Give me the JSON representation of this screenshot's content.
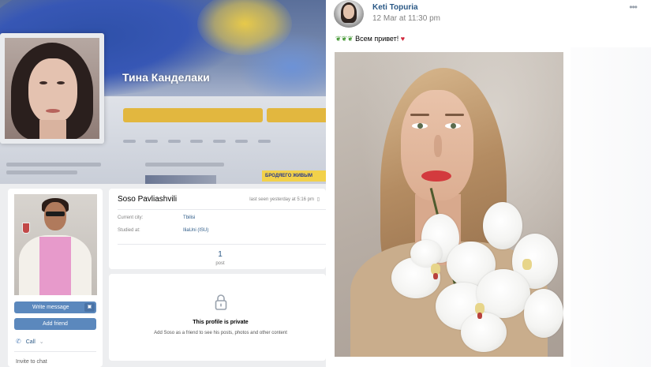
{
  "top_left": {
    "profile_name": "Тина Канделаки",
    "tag": "БРОДЯЕГО ЖИВЫМ"
  },
  "bottom_left": {
    "profile_name": "Soso Pavliashvili",
    "last_seen": "last seen yesterday at 5:16 pm",
    "info_rows": [
      {
        "label": "Current city:",
        "value": "Tbilisi"
      },
      {
        "label": "Studied at:",
        "value": "IliaUni (ISU)"
      }
    ],
    "post_count": "1",
    "post_label": "post",
    "write_message_label": "Write message",
    "add_friend_label": "Add friend",
    "call_label": "Call",
    "invite_label": "Invite to chat",
    "private_title": "This profile is private",
    "private_subtitle": "Add Soso as a friend to see his posts, photos and other content"
  },
  "post": {
    "author": "Keti Topuria",
    "date": "12 Mar at 11:30 pm",
    "text": "Всем привет!",
    "more_icon": "ellipsis-icon",
    "herb_icon": "herb-emoji-icon",
    "lips_icon": "kiss-mark-emoji-icon"
  },
  "colors": {
    "vk_link": "#2a5885",
    "vk_button": "#5b88bd",
    "vk_bg": "#edeef0",
    "muted": "#828282",
    "gold_button": "#e2b73f"
  }
}
